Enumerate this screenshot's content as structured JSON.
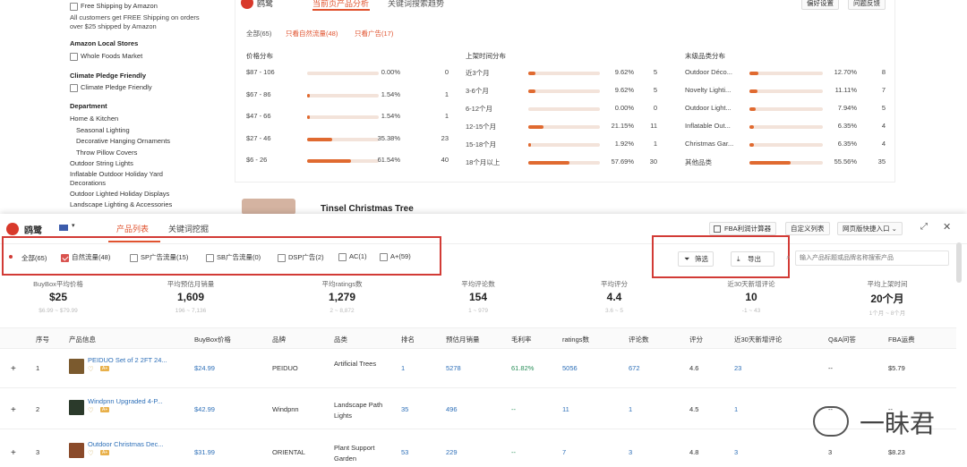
{
  "sidebar": {
    "free_shipping": "Free Shipping by Amazon",
    "free_shipping_note1": "All customers get FREE Shipping on orders",
    "free_shipping_note2": "over $25 shipped by Amazon",
    "local_stores": "Amazon Local Stores",
    "whole_foods": "Whole Foods Market",
    "climate_head": "Climate Pledge Friendly",
    "climate_opt": "Climate Pledge Friendly",
    "department": "Department",
    "dept_items": [
      "Home & Kitchen",
      "Seasonal Lighting",
      "Decorative Hanging Ornaments",
      "Throw Pillow Covers",
      "Outdoor String Lights",
      "Inflatable Outdoor Holiday Yard",
      "Decorations",
      "Outdoor Lighted Holiday Displays",
      "Landscape Lighting & Accessories"
    ]
  },
  "top_panel": {
    "brand": "鸥鹭",
    "tab_active": "当前页产品分析",
    "tab_other": "关键词搜索趋势",
    "btn_pref": "偏好设置",
    "btn_feedback": "问题反馈",
    "filters": [
      "全部(65)",
      "只看自然流量(48)",
      "只看广告(17)"
    ],
    "price": {
      "title": "价格分布",
      "rows": [
        {
          "label": "$87 - 106",
          "pct": "0.00%",
          "count": "0",
          "fill": 0
        },
        {
          "label": "$67 - 86",
          "pct": "1.54%",
          "count": "1",
          "fill": 0.0154
        },
        {
          "label": "$47 - 66",
          "pct": "1.54%",
          "count": "1",
          "fill": 0.0154
        },
        {
          "label": "$27 - 46",
          "pct": "35.38%",
          "count": "23",
          "fill": 0.3538
        },
        {
          "label": "$6 - 26",
          "pct": "61.54%",
          "count": "40",
          "fill": 0.6154
        }
      ]
    },
    "launch": {
      "title": "上架时间分布",
      "rows": [
        {
          "label": "近3个月",
          "pct": "9.62%",
          "count": "5",
          "fill": 0.0962
        },
        {
          "label": "3-6个月",
          "pct": "9.62%",
          "count": "5",
          "fill": 0.0962
        },
        {
          "label": "6-12个月",
          "pct": "0.00%",
          "count": "0",
          "fill": 0
        },
        {
          "label": "12-15个月",
          "pct": "21.15%",
          "count": "11",
          "fill": 0.2115
        },
        {
          "label": "15-18个月",
          "pct": "1.92%",
          "count": "1",
          "fill": 0.0192
        },
        {
          "label": "18个月以上",
          "pct": "57.69%",
          "count": "30",
          "fill": 0.5769
        }
      ]
    },
    "category": {
      "title": "末级品类分布",
      "rows": [
        {
          "label": "Outdoor Déco...",
          "pct": "12.70%",
          "count": "8",
          "fill": 0.127
        },
        {
          "label": "Novelty Lighti...",
          "pct": "11.11%",
          "count": "7",
          "fill": 0.1111
        },
        {
          "label": "Outdoor Light...",
          "pct": "7.94%",
          "count": "5",
          "fill": 0.0794
        },
        {
          "label": "Inflatable Out...",
          "pct": "6.35%",
          "count": "4",
          "fill": 0.0635
        },
        {
          "label": "Christmas Gar...",
          "pct": "6.35%",
          "count": "4",
          "fill": 0.0635
        },
        {
          "label": "其他品类",
          "pct": "55.56%",
          "count": "35",
          "fill": 0.5556
        }
      ]
    }
  },
  "behind": {
    "product_title": "Tinsel Christmas Tree"
  },
  "bottom_panel": {
    "brand": "鸥鹭",
    "tab_active": "产品列表",
    "tab_other": "关键词挖掘",
    "btn_fba": "FBA利润计算器",
    "btn_custom": "自定义列表",
    "btn_entry": "网页版快捷入口",
    "filters": [
      {
        "label": "全部(65)",
        "checked": false,
        "dot": true
      },
      {
        "label": "自然流量(48)",
        "checked": true
      },
      {
        "label": "SP广告流量(15)",
        "checked": false
      },
      {
        "label": "SB广告流量(0)",
        "checked": false
      },
      {
        "label": "DSP广告(2)",
        "checked": false
      },
      {
        "label": "AC(1)",
        "checked": false
      },
      {
        "label": "A+(59)",
        "checked": false
      }
    ],
    "btn_filter": "筛选",
    "btn_export": "导出",
    "search_placeholder": "输入产品标题或品牌名称搜索产品",
    "stats": [
      {
        "label": "BuyBox平均价格",
        "value": "$25",
        "range": "$6.99 ~ $79.99"
      },
      {
        "label": "平均预估月销量",
        "value": "1,609",
        "range": "196 ~ 7,136"
      },
      {
        "label": "平均ratings数",
        "value": "1,279",
        "range": "2 ~ 8,872"
      },
      {
        "label": "平均评论数",
        "value": "154",
        "range": "1 ~ 979"
      },
      {
        "label": "平均评分",
        "value": "4.4",
        "range": "3.6 ~ 5"
      },
      {
        "label": "近30天新增评论",
        "value": "10",
        "range": "-1 ~ 43"
      },
      {
        "label": "平均上架时间",
        "value": "20个月",
        "range": "1个月 ~ 8个月"
      }
    ],
    "table_headers": [
      "序号",
      "产品信息",
      "BuyBox价格",
      "品牌",
      "品类",
      "排名",
      "预估月销量",
      "毛利率",
      "ratings数",
      "评论数",
      "评分",
      "近30天新增评论",
      "Q&A问答",
      "FBA运费"
    ],
    "rows": [
      {
        "idx": "1",
        "title": "PEIDUO Set of 2 2FT 24...",
        "price": "$24.99",
        "brand": "PEIDUO",
        "category": "Artificial Trees",
        "rank": "1",
        "sales": "5278",
        "margin": "61.82%",
        "ratings": "5056",
        "reviews": "672",
        "rating": "4.6",
        "new_reviews": "23",
        "qa": "--",
        "fba": "$5.79"
      },
      {
        "idx": "2",
        "title": "Windpnn Upgraded 4-P...",
        "price": "$42.99",
        "brand": "Windpnn",
        "category": "Landscape Path Lights",
        "rank": "35",
        "sales": "496",
        "margin": "--",
        "ratings": "11",
        "reviews": "1",
        "rating": "4.5",
        "new_reviews": "1",
        "qa": "--",
        "fba": "--"
      },
      {
        "idx": "3",
        "title": "Outdoor Christmas Dec...",
        "price": "$31.99",
        "brand": "ORIENTAL",
        "category": "Plant Support Garden",
        "rank": "53",
        "sales": "229",
        "margin": "--",
        "ratings": "7",
        "reviews": "3",
        "rating": "4.8",
        "new_reviews": "3",
        "qa": "3",
        "fba": "$8.23"
      }
    ],
    "badge_a": "A+"
  },
  "watermark": "一眛君"
}
